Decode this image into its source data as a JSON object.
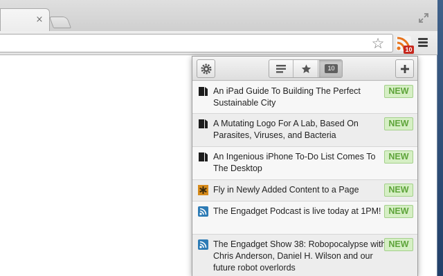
{
  "browser": {
    "tab": {
      "close_glyph": "×"
    },
    "toolbar": {
      "star_glyph": "☆",
      "extension_badge": "10"
    }
  },
  "popup": {
    "toolbar": {
      "unread_count": "10",
      "add_glyph": "+"
    },
    "items": [
      {
        "icon": "bookmark-doc-icon",
        "title": "An iPad Guide To Building The Perfect Sustainable City",
        "badge": "NEW"
      },
      {
        "icon": "bookmark-doc-icon",
        "title": "A Mutating Logo For A Lab, Based On Parasites, Viruses, and Bacteria",
        "badge": "NEW"
      },
      {
        "icon": "bookmark-doc-icon",
        "title": "An Ingenious iPhone To-Do List Comes To The Desktop",
        "badge": "NEW"
      },
      {
        "icon": "asterisk-feed-icon",
        "title": "Fly in Newly Added Content to a Page",
        "badge": "NEW"
      },
      {
        "icon": "rss-feed-icon",
        "title": "The Engadget Podcast is live today at 1PM!",
        "badge": "NEW"
      },
      {
        "icon": "rss-feed-icon",
        "title": "The Engadget Show 38: Robopocalypse with Chris Anderson, Daniel H. Wilson and our future robot overlords",
        "badge": "NEW"
      }
    ]
  },
  "colors": {
    "new_badge_bg": "#d6efc5",
    "new_badge_text": "#5ea43a",
    "rss_orange": "#e8741c",
    "feed_blue": "#2d7bb5"
  }
}
